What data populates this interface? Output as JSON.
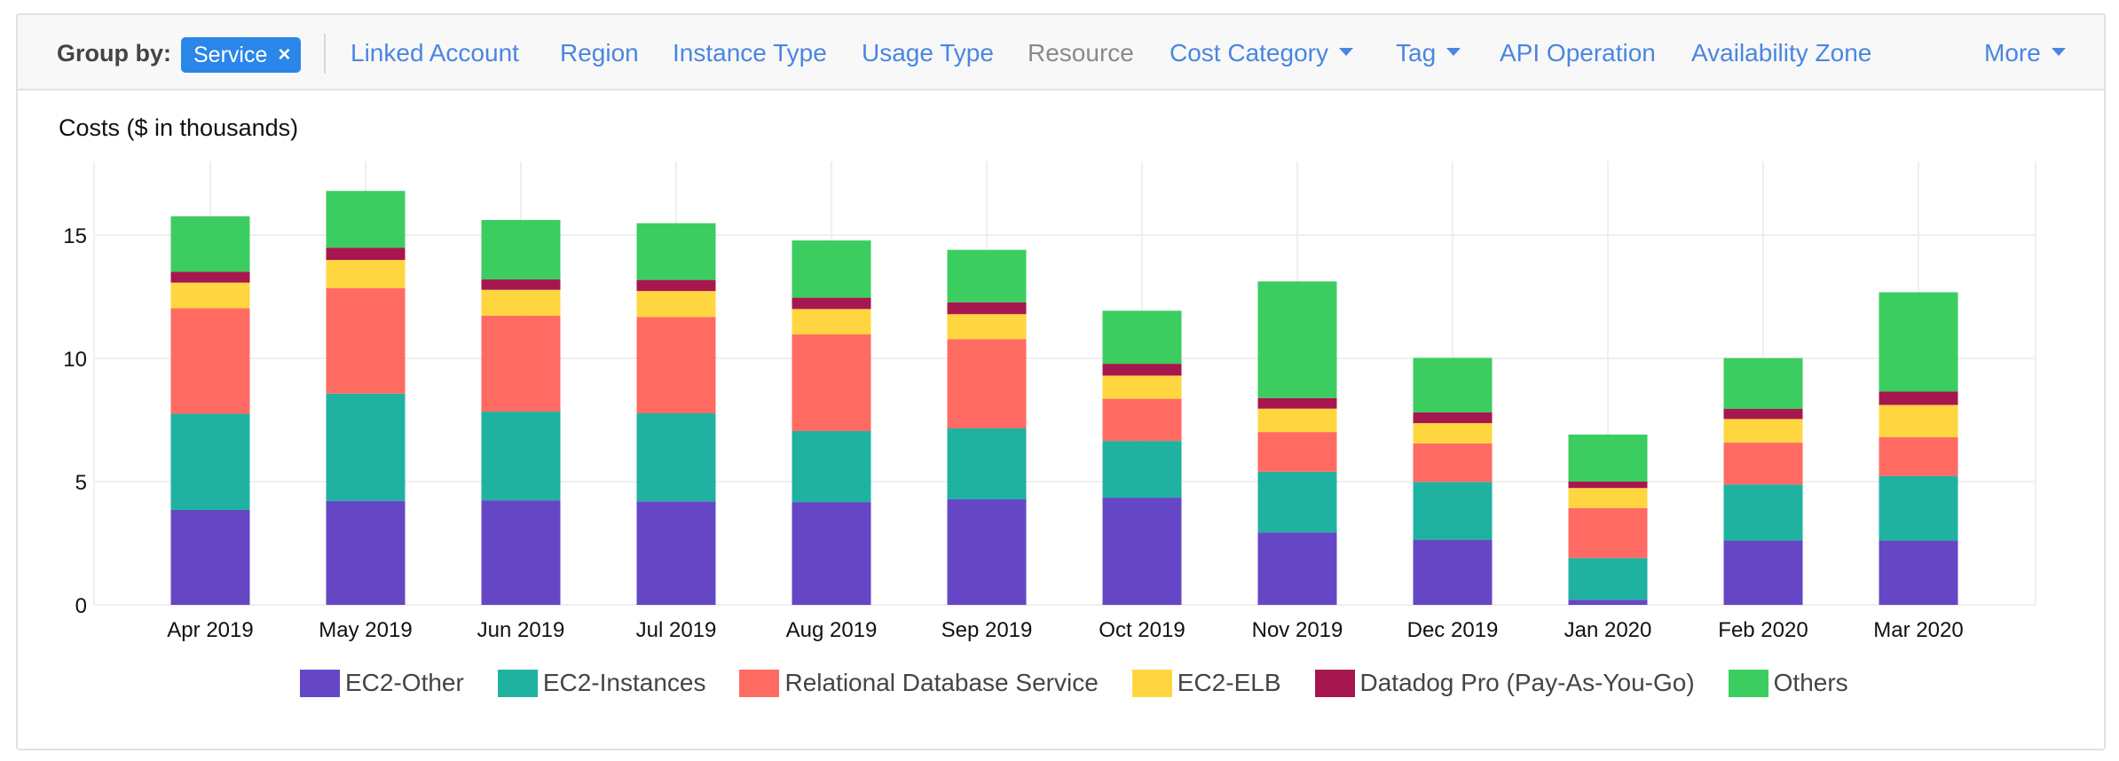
{
  "toolbar": {
    "group_by_label": "Group by:",
    "selected_chip": "Service",
    "chip_remove_icon": "×",
    "links": [
      {
        "label": "Linked Account",
        "dropdown": false,
        "disabled": false
      },
      {
        "label": "Region",
        "dropdown": false,
        "disabled": false
      },
      {
        "label": "Instance Type",
        "dropdown": false,
        "disabled": false
      },
      {
        "label": "Usage Type",
        "dropdown": false,
        "disabled": false
      },
      {
        "label": "Resource",
        "dropdown": false,
        "disabled": true
      },
      {
        "label": "Cost Category",
        "dropdown": true,
        "disabled": false
      },
      {
        "label": "Tag",
        "dropdown": true,
        "disabled": false
      },
      {
        "label": "API Operation",
        "dropdown": false,
        "disabled": false
      },
      {
        "label": "Availability Zone",
        "dropdown": false,
        "disabled": false
      },
      {
        "label": "More",
        "dropdown": true,
        "disabled": false
      }
    ]
  },
  "colors": {
    "chip_bg": "#2a86e8",
    "link": "#4a86e0",
    "grid": "#efefef"
  },
  "chart_data": {
    "type": "bar",
    "stacked": true,
    "title": "Costs ($ in thousands)",
    "xlabel": "",
    "ylabel": "Costs ($ in thousands)",
    "ylim": [
      0,
      18
    ],
    "yticks": [
      0,
      5,
      10,
      15
    ],
    "grid": true,
    "legend_position": "bottom",
    "categories": [
      "Apr 2019",
      "May 2019",
      "Jun 2019",
      "Jul 2019",
      "Aug 2019",
      "Sep 2019",
      "Oct 2019",
      "Nov 2019",
      "Dec 2019",
      "Jan 2020",
      "Feb 2020",
      "Mar 2020"
    ],
    "series": [
      {
        "name": "EC2-Other",
        "color": "#6547c6",
        "values": [
          3.85,
          4.22,
          4.24,
          4.2,
          4.17,
          4.28,
          4.35,
          2.94,
          2.64,
          0.21,
          2.61,
          2.61
        ]
      },
      {
        "name": "EC2-Instances",
        "color": "#1fb2a1",
        "values": [
          3.9,
          4.35,
          3.6,
          3.57,
          2.88,
          2.88,
          2.3,
          2.46,
          2.35,
          1.69,
          2.27,
          2.62
        ]
      },
      {
        "name": "Relational Database Service",
        "color": "#ff6b63",
        "values": [
          4.28,
          4.28,
          3.89,
          3.91,
          3.92,
          3.62,
          1.71,
          1.61,
          1.56,
          2.03,
          1.7,
          1.57
        ]
      },
      {
        "name": "EC2-ELB",
        "color": "#ffd63f",
        "values": [
          1.04,
          1.14,
          1.05,
          1.05,
          1.03,
          1.01,
          0.94,
          0.95,
          0.82,
          0.81,
          0.96,
          1.31
        ]
      },
      {
        "name": "Datadog Pro (Pay-As-You-Go)",
        "color": "#a7174f",
        "values": [
          0.44,
          0.5,
          0.42,
          0.45,
          0.46,
          0.48,
          0.48,
          0.43,
          0.44,
          0.26,
          0.41,
          0.54
        ]
      },
      {
        "name": "Others",
        "color": "#3ccd60",
        "values": [
          2.25,
          2.3,
          2.41,
          2.3,
          2.32,
          2.13,
          2.15,
          4.73,
          2.21,
          1.91,
          2.06,
          4.03
        ]
      }
    ]
  }
}
